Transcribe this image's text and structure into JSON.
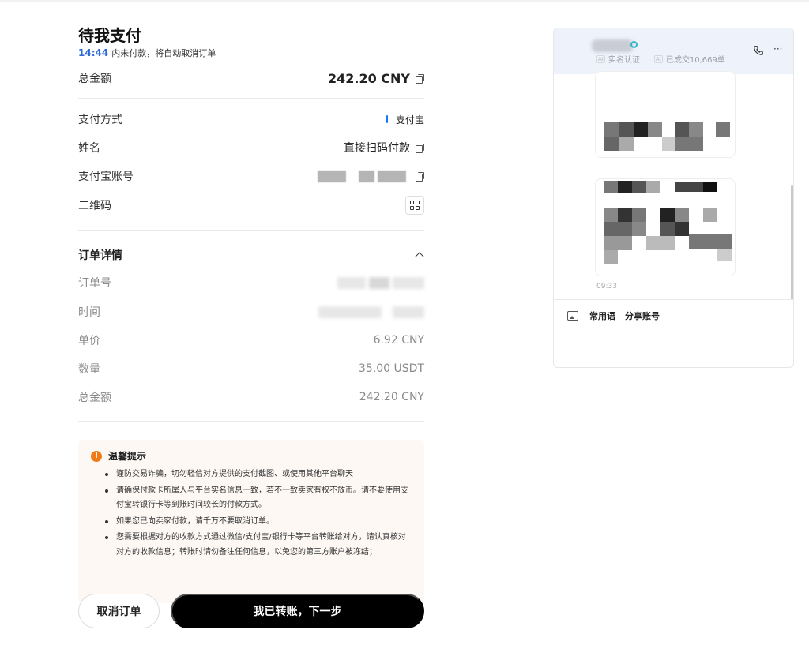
{
  "page": {
    "title": "待我支付",
    "countdown": "14:44",
    "countdown_note": "内未付款，将自动取消订单"
  },
  "summary": {
    "total_label": "总金额",
    "total_value": "242.20 CNY"
  },
  "payment": {
    "method_label": "支付方式",
    "method_value": "支付宝",
    "name_label": "姓名",
    "name_value": "直接扫码付款",
    "account_label": "支付宝账号",
    "qr_label": "二维码"
  },
  "order": {
    "section_title": "订单详情",
    "order_no_label": "订单号",
    "time_label": "时间",
    "unit_price_label": "单价",
    "unit_price_value": "6.92 CNY",
    "quantity_label": "数量",
    "quantity_value": "35.00 USDT",
    "total_label": "总金额",
    "total_value": "242.20 CNY"
  },
  "notice": {
    "title": "温馨提示",
    "items": [
      "谨防交易诈骗，切勿轻信对方提供的支付截图、或使用其他平台聊天",
      "请确保付款卡所属人与平台实名信息一致，若不一致卖家有权不放币。请不要使用支付宝转银行卡等到账时间较长的付款方式。",
      "如果您已向卖家付款，请千万不要取消订单。",
      "您需要根据对方的收款方式通过微信/支付宝/银行卡等平台转账给对方，请认真核对对方的收款信息；转账时请勿备注任何信息，以免您的第三方账户被冻结；"
    ]
  },
  "actions": {
    "cancel_label": "取消订单",
    "next_label": "我已转账，下一步"
  },
  "chat": {
    "verified_label": "实名认证",
    "deals_label": "已成交10,669单",
    "message_time": "09:33",
    "quick_phrases_label": "常用语",
    "share_account_label": "分享账号"
  },
  "icons": {
    "copy": "copy-icon",
    "qr": "qr-code-icon",
    "chevron": "chevron-up-icon",
    "warning": "warning-icon",
    "phone": "phone-icon",
    "more": "more-icon",
    "image": "image-icon"
  },
  "colors": {
    "countdown": "#2f6bd8",
    "alipay": "#1677ff",
    "warning": "#ef7a1a",
    "primary_button": "#000000",
    "notice_bg": "#fdf8f4",
    "chat_header_bg": "#eef2fb"
  }
}
